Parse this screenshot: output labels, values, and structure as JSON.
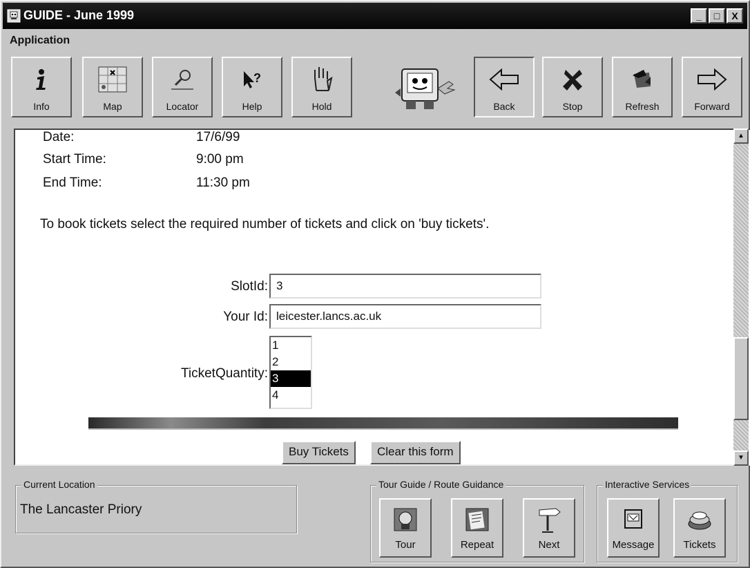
{
  "window": {
    "title": "GUIDE - June 1999",
    "controls": [
      "_",
      "□",
      "X"
    ]
  },
  "menubar": {
    "items": [
      "Application"
    ]
  },
  "toolbar": {
    "buttons": [
      {
        "label": "Info",
        "icon": "info-icon"
      },
      {
        "label": "Map",
        "icon": "map-icon"
      },
      {
        "label": "Locator",
        "icon": "magnifier-icon"
      },
      {
        "label": "Help",
        "icon": "help-icon"
      },
      {
        "label": "Hold",
        "icon": "hand-icon"
      },
      {
        "label": "Back",
        "icon": "arrow-left-icon"
      },
      {
        "label": "Stop",
        "icon": "stop-x-icon"
      },
      {
        "label": "Refresh",
        "icon": "refresh-icon"
      },
      {
        "label": "Forward",
        "icon": "arrow-right-icon"
      }
    ],
    "mascot_icon": "guide-mascot-icon"
  },
  "event": {
    "date_label": "Date:",
    "date": "17/6/99",
    "start_label": "Start Time:",
    "start": "9:00 pm",
    "end_label": "End Time:",
    "end": "11:30 pm"
  },
  "instructions": "To book tickets select the required number of tickets and click on 'buy tickets'.",
  "form": {
    "slot_label": "SlotId:",
    "slot_value": "3",
    "yourid_label": "Your Id:",
    "yourid_value": "leicester.lancs.ac.uk",
    "quantity_label": "TicketQuantity:",
    "quantity_options": [
      "1",
      "2",
      "3",
      "4"
    ],
    "quantity_selected": "3",
    "buy_label": "Buy Tickets",
    "clear_label": "Clear this form"
  },
  "status": {
    "location_group": "Current Location",
    "location": "The Lancaster Priory",
    "tour_group": "Tour Guide / Route Guidance",
    "tour_buttons": [
      {
        "label": "Tour",
        "icon": "tour-guide-icon"
      },
      {
        "label": "Repeat",
        "icon": "repeat-notes-icon"
      },
      {
        "label": "Next",
        "icon": "signpost-icon"
      }
    ],
    "services_group": "Interactive Services",
    "service_buttons": [
      {
        "label": "Message",
        "icon": "message-tv-icon"
      },
      {
        "label": "Tickets",
        "icon": "tickets-reel-icon"
      }
    ]
  }
}
